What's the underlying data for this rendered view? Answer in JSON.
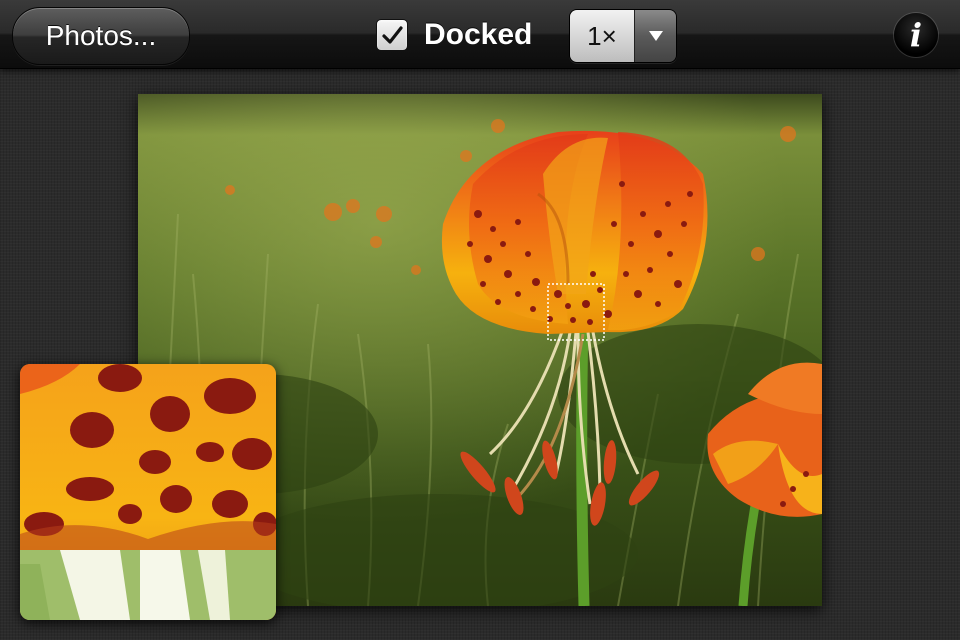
{
  "toolbar": {
    "photos_label": "Photos...",
    "docked_label": "Docked",
    "docked_checked": true,
    "zoom_value": "1×",
    "info_glyph": "i"
  },
  "icons": {
    "checkbox": "checkmark-icon",
    "zoom_dropdown": "triangle-down-icon",
    "info": "info-icon"
  },
  "colors": {
    "toolbar_bg": "#1c1c1c",
    "background": "#2b2b2b",
    "petal_orange": "#e8501a",
    "petal_yellow": "#f4b400",
    "spot": "#8a1a10",
    "foliage": "#4f6b24"
  }
}
